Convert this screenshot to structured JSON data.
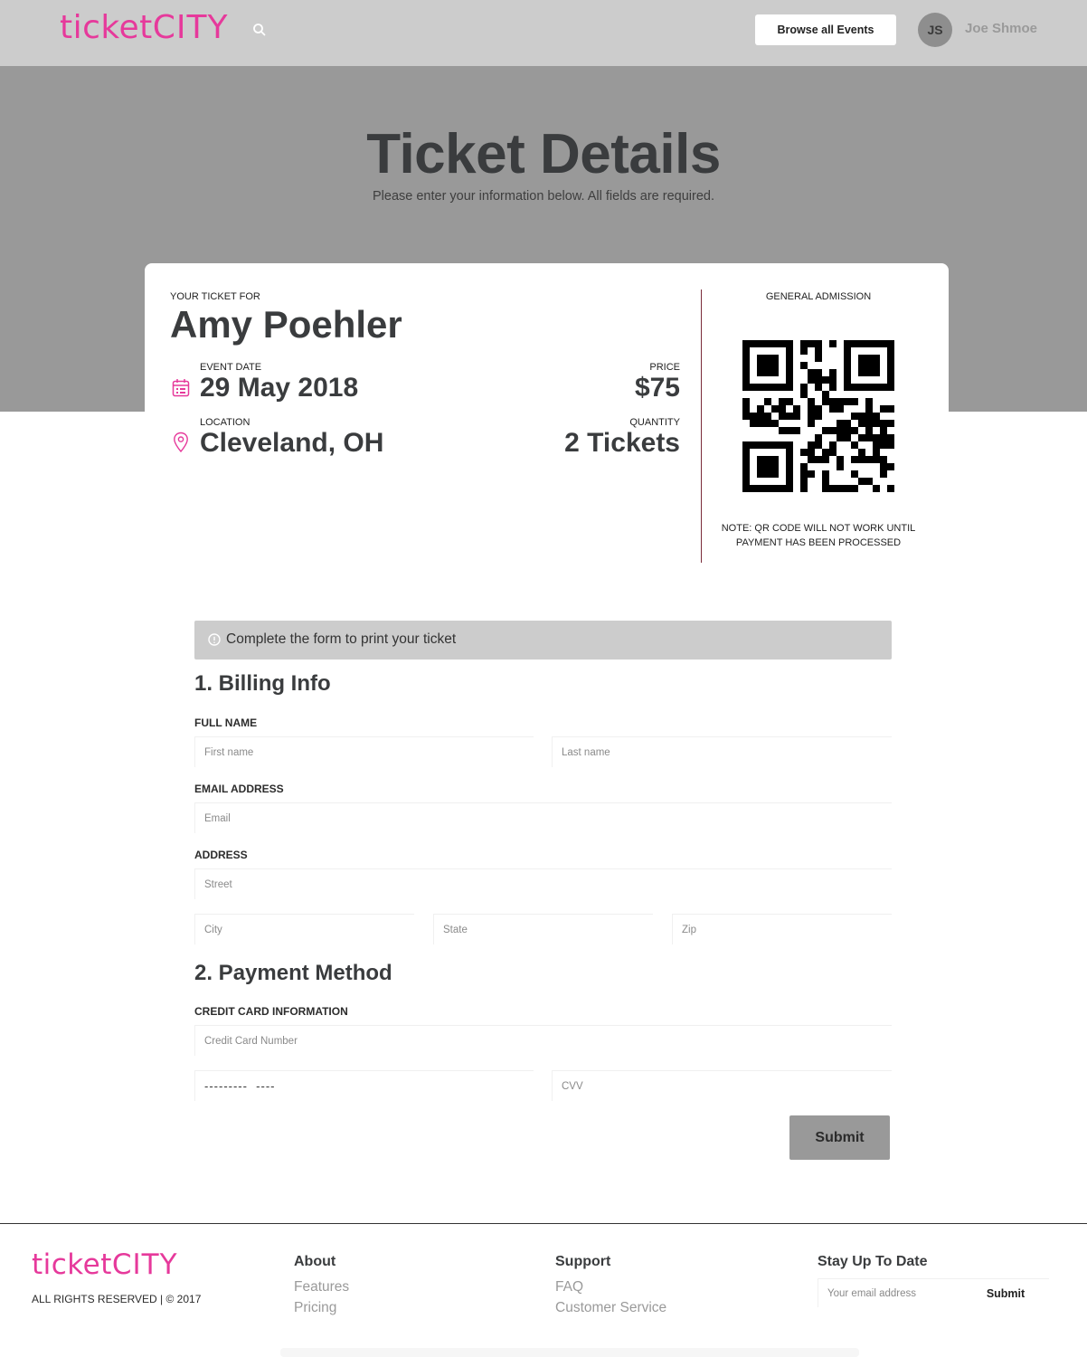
{
  "header": {
    "logo_thin": "ticket",
    "logo_bold": "CITY",
    "search_icon": "search-icon",
    "browse_label": "Browse all Events",
    "user_initials": "JS",
    "user_name": "Joe Shmoe"
  },
  "hero": {
    "title": "Ticket Details",
    "subtitle": "Please enter your information below. All fields are required."
  },
  "ticket": {
    "for_label": "YOUR TICKET FOR",
    "name": "Amy Poehler",
    "event_date_label": "EVENT DATE",
    "event_date": "29 May 2018",
    "location_label": "LOCATION",
    "location": "Cleveland, OH",
    "price_label": "PRICE",
    "price": "$75",
    "quantity_label": "QUANTITY",
    "quantity": "2 Tickets",
    "admission_label": "GENERAL ADMISSION",
    "qr_note_line1": "NOTE: QR CODE WILL NOT WORK UNTIL",
    "qr_note_line2": "PAYMENT HAS BEEN PROCESSED",
    "calendar_icon": "calendar-icon",
    "location_icon": "map-pin-icon",
    "accent_color": "#e6399b"
  },
  "form": {
    "alert": "Complete the form to print your ticket",
    "alert_icon": "info-icon",
    "billing_title": "1. Billing Info",
    "full_name_label": "FULL NAME",
    "first_name_placeholder": "First name",
    "last_name_placeholder": "Last name",
    "email_label": "EMAIL ADDRESS",
    "email_placeholder": "Email",
    "address_label": "ADDRESS",
    "street_placeholder": "Street",
    "city_placeholder": "City",
    "state_placeholder": "State",
    "zip_placeholder": "Zip",
    "payment_title": "2. Payment Method",
    "cc_label": "CREDIT CARD INFORMATION",
    "cc_placeholder": "Credit Card Number",
    "expiry_value": "---------  ----",
    "cvv_placeholder": "CVV",
    "submit_label": "Submit"
  },
  "footer": {
    "logo_thin": "ticket",
    "logo_bold": "CITY",
    "rights": "ALL RIGHTS RESERVED | © 2017",
    "about_title": "About",
    "about_links": [
      "Features",
      "Pricing"
    ],
    "support_title": "Support",
    "support_links": [
      "FAQ",
      "Customer Service"
    ],
    "newsletter_title": "Stay Up To Date",
    "newsletter_placeholder": "Your email address",
    "newsletter_submit": "Submit"
  }
}
